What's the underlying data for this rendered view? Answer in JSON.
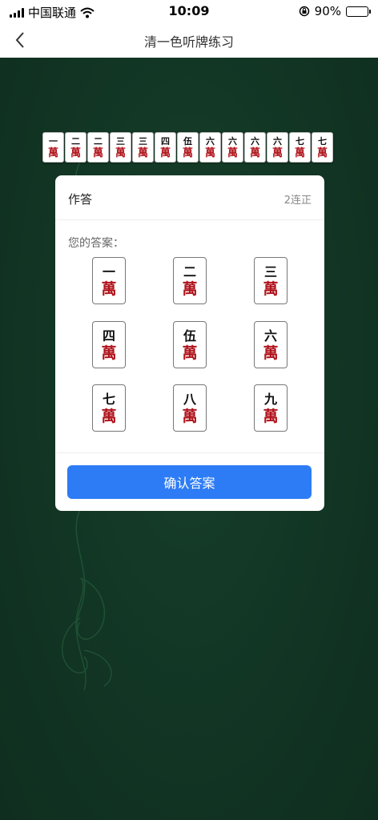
{
  "status_bar": {
    "carrier": "中国联通",
    "time": "10:09",
    "battery_percent": "90%",
    "battery_level": 0.9,
    "icons": [
      "signal-icon",
      "wifi-icon",
      "rotation-lock-icon",
      "battery-icon"
    ]
  },
  "nav": {
    "back_icon": "chevron-left-icon",
    "title": "清一色听牌练习"
  },
  "hand": {
    "tiles": [
      {
        "num": "一",
        "suit": "萬"
      },
      {
        "num": "二",
        "suit": "萬"
      },
      {
        "num": "二",
        "suit": "萬"
      },
      {
        "num": "三",
        "suit": "萬"
      },
      {
        "num": "三",
        "suit": "萬"
      },
      {
        "num": "四",
        "suit": "萬"
      },
      {
        "num": "伍",
        "suit": "萬"
      },
      {
        "num": "六",
        "suit": "萬"
      },
      {
        "num": "六",
        "suit": "萬"
      },
      {
        "num": "六",
        "suit": "萬"
      },
      {
        "num": "六",
        "suit": "萬"
      },
      {
        "num": "七",
        "suit": "萬"
      },
      {
        "num": "七",
        "suit": "萬"
      }
    ]
  },
  "answer_card": {
    "title": "作答",
    "streak": "2连正",
    "answer_label": "您的答案：",
    "choices": [
      {
        "num": "一",
        "suit": "萬"
      },
      {
        "num": "二",
        "suit": "萬"
      },
      {
        "num": "三",
        "suit": "萬"
      },
      {
        "num": "四",
        "suit": "萬"
      },
      {
        "num": "伍",
        "suit": "萬"
      },
      {
        "num": "六",
        "suit": "萬"
      },
      {
        "num": "七",
        "suit": "萬"
      },
      {
        "num": "八",
        "suit": "萬"
      },
      {
        "num": "九",
        "suit": "萬"
      }
    ],
    "confirm_label": "确认答案"
  },
  "colors": {
    "felt": "#123524",
    "accent": "#2d7cf6",
    "wan_red": "#b0141c"
  }
}
